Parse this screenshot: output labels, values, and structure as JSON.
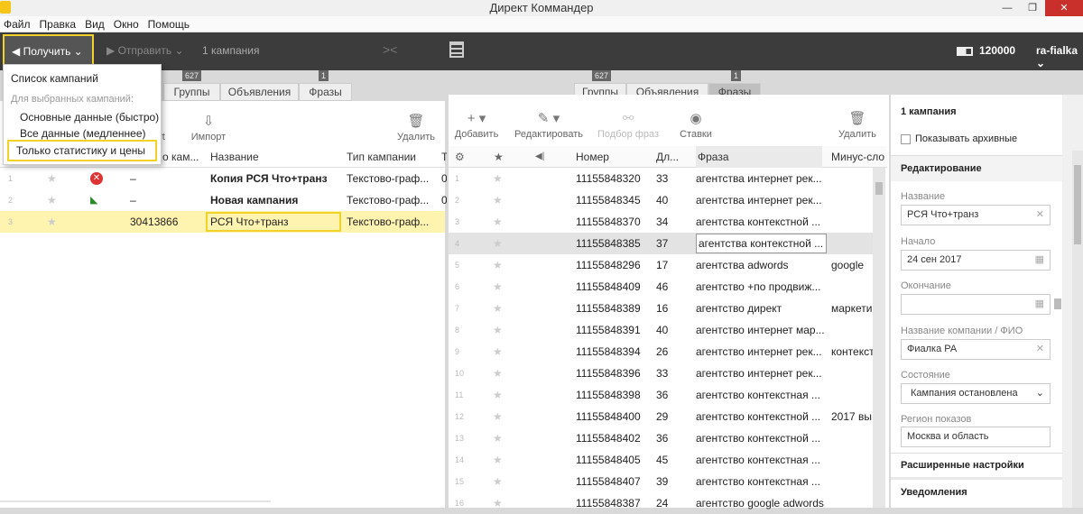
{
  "app": {
    "title": "Директ Коммандер"
  },
  "menu": [
    "Файл",
    "Правка",
    "Вид",
    "Окно",
    "Помощь"
  ],
  "toolbar": {
    "get_label": "Получить",
    "send_label": "Отправить",
    "campaigns_count": "1 кампания",
    "points": "120000",
    "user": "ra-fialka"
  },
  "dropdown": {
    "items": [
      "Список кампаний",
      "Для выбранных кампаний:",
      "Основные данные (быстро)",
      "Все данные (медленнее)",
      "Только статистику и цены"
    ]
  },
  "left": {
    "tabs": [
      "Группы",
      "Объявления",
      "Фразы"
    ],
    "badges": [
      "627",
      "1"
    ],
    "toolbar": [
      "ort",
      "Импорт",
      "Удалить"
    ],
    "headers": [
      "о кам...",
      "Название",
      "Тип кампании",
      "Т"
    ],
    "rows": [
      {
        "n": "1",
        "num": "–",
        "name": "Копия РСЯ Что+транз",
        "type": "Текстово-граф...",
        "extra": "0"
      },
      {
        "n": "2",
        "num": "–",
        "name": "Новая кампания",
        "type": "Текстово-граф...",
        "extra": "0"
      },
      {
        "n": "3",
        "num": "30413866",
        "name": "РСЯ Что+транз",
        "type": "Текстово-граф...",
        "extra": ""
      }
    ]
  },
  "right": {
    "tabs": [
      "Группы",
      "Объявления",
      "Фразы"
    ],
    "badges": [
      "627",
      "1"
    ],
    "toolbar": [
      "Добавить",
      "Редактировать",
      "Подбор фраз",
      "Ставки",
      "Удалить"
    ],
    "headers": [
      "Номер",
      "Дл...",
      "Фраза",
      "Минус-сло"
    ],
    "rows": [
      {
        "n": "1",
        "num": "11155848320",
        "len": "33",
        "phrase": "агентства интернет рек...",
        "minus": ""
      },
      {
        "n": "2",
        "num": "11155848345",
        "len": "40",
        "phrase": "агентства интернет рек...",
        "minus": ""
      },
      {
        "n": "3",
        "num": "11155848370",
        "len": "34",
        "phrase": "агентства контекстной ...",
        "minus": ""
      },
      {
        "n": "4",
        "num": "11155848385",
        "len": "37",
        "phrase": "агентства контекстной ...",
        "minus": ""
      },
      {
        "n": "5",
        "num": "11155848296",
        "len": "17",
        "phrase": "агентства adwords",
        "minus": "google"
      },
      {
        "n": "6",
        "num": "11155848409",
        "len": "46",
        "phrase": "агентство +по продвиж...",
        "minus": ""
      },
      {
        "n": "7",
        "num": "11155848389",
        "len": "16",
        "phrase": "агентство директ",
        "minus": "маркети"
      },
      {
        "n": "8",
        "num": "11155848391",
        "len": "40",
        "phrase": "агентство интернет мар...",
        "minus": ""
      },
      {
        "n": "9",
        "num": "11155848394",
        "len": "26",
        "phrase": "агентство интернет рек...",
        "minus": "контекст"
      },
      {
        "n": "10",
        "num": "11155848396",
        "len": "33",
        "phrase": "агентство интернет рек...",
        "minus": ""
      },
      {
        "n": "11",
        "num": "11155848398",
        "len": "36",
        "phrase": "агентство контекстная ...",
        "minus": ""
      },
      {
        "n": "12",
        "num": "11155848400",
        "len": "29",
        "phrase": "агентство контекстной ...",
        "minus": "2017 вы"
      },
      {
        "n": "13",
        "num": "11155848402",
        "len": "36",
        "phrase": "агентство контекстной ...",
        "minus": ""
      },
      {
        "n": "14",
        "num": "11155848405",
        "len": "45",
        "phrase": "агентство контекстная ...",
        "minus": ""
      },
      {
        "n": "15",
        "num": "11155848407",
        "len": "39",
        "phrase": "агентство контекстная ...",
        "minus": ""
      },
      {
        "n": "16",
        "num": "11155848387",
        "len": "24",
        "phrase": "агентство google adwords",
        "minus": ""
      }
    ]
  },
  "side": {
    "title": "1 кампания",
    "show_archive": "Показывать архивные",
    "editing": "Редактирование",
    "name_label": "Название",
    "name_value": "РСЯ Что+транз",
    "start_label": "Начало",
    "start_value": "24 сен 2017",
    "end_label": "Окончание",
    "company_label": "Название компании / ФИО",
    "company_value": "Фиалка РА",
    "state_label": "Состояние",
    "state_value": "Кампания остановлена",
    "region_label": "Регион показов",
    "region_value": "Москва и область",
    "advanced": "Расширенные настройки",
    "notifications": "Уведомления"
  },
  "colors": {
    "highlight": "#f0d22a",
    "selected_row": "#fff3b0",
    "toolbar_bg": "#3c3c3c"
  }
}
